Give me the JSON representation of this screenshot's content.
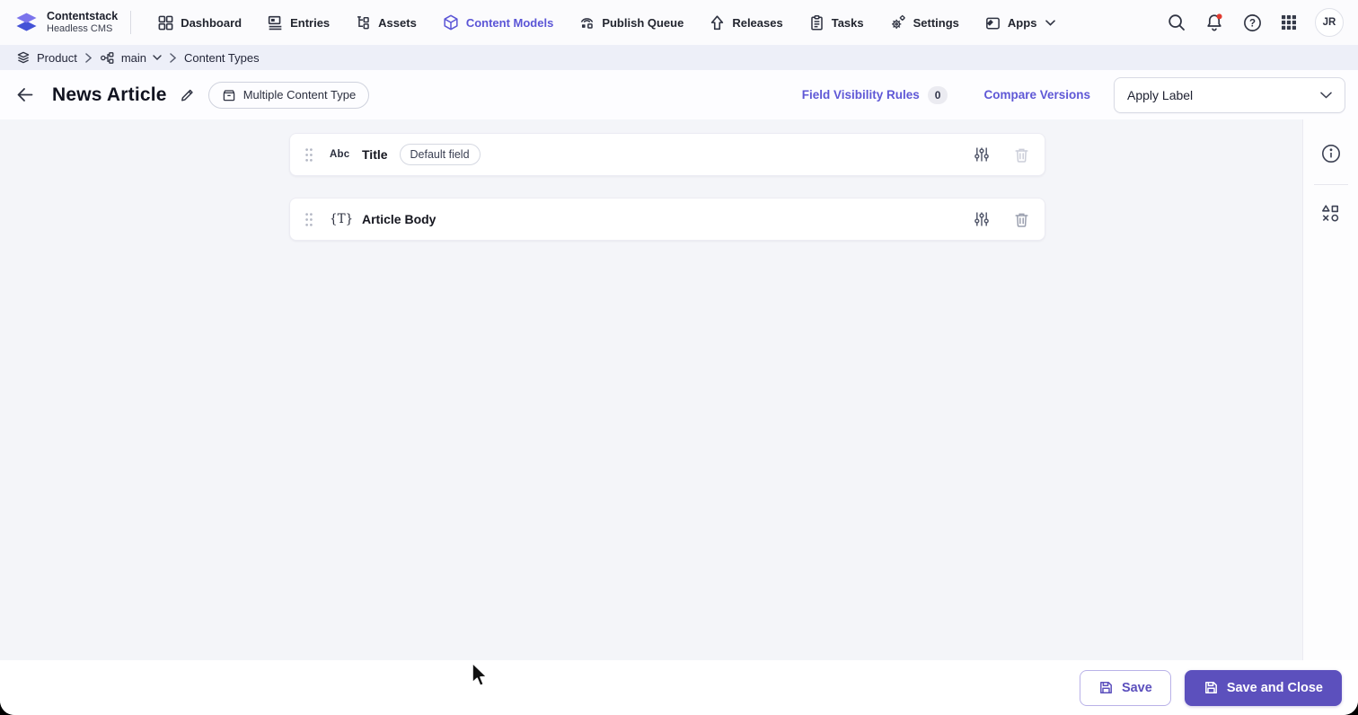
{
  "topnav": {
    "brand": {
      "title": "Contentstack",
      "subtitle": "Headless CMS"
    },
    "items": [
      {
        "label": "Dashboard",
        "active": false
      },
      {
        "label": "Entries",
        "active": false
      },
      {
        "label": "Assets",
        "active": false
      },
      {
        "label": "Content Models",
        "active": true
      },
      {
        "label": "Publish Queue",
        "active": false
      },
      {
        "label": "Releases",
        "active": false
      },
      {
        "label": "Tasks",
        "active": false
      },
      {
        "label": "Settings",
        "active": false
      },
      {
        "label": "Apps",
        "active": false
      }
    ],
    "right": {
      "avatar_initials": "JR",
      "has_notification_dot": true
    }
  },
  "breadcrumb": {
    "stack": "Product",
    "branch": "main",
    "section": "Content Types"
  },
  "page_header": {
    "title": "News Article",
    "content_type_badge": "Multiple Content Type",
    "field_visibility_rules_label": "Field Visibility Rules",
    "field_visibility_rules_count": "0",
    "compare_versions_label": "Compare Versions",
    "apply_label_placeholder": "Apply Label"
  },
  "fields": [
    {
      "name": "Title",
      "icon_glyph": "Abc",
      "type": "single-line-text",
      "badge": "Default field"
    },
    {
      "name": "Article Body",
      "icon_glyph": "{T}",
      "type": "json-rich-text",
      "badge": null
    }
  ],
  "footer": {
    "save_label": "Save",
    "save_and_close_label": "Save and Close"
  },
  "icons": {
    "dashboard-icon": "2x2 grid squares",
    "entries-icon": "document with lines",
    "assets-icon": "folder tree",
    "content-models-icon": "3d cube",
    "publish-queue-icon": "broadcast arcs over blocks",
    "releases-icon": "hollow up arrow",
    "tasks-icon": "clipboard",
    "settings-icon": "two gears",
    "apps-icon": "box with tag",
    "search-icon": "magnifier",
    "notifications-icon": "bell with red dot",
    "help-icon": "question mark circle",
    "app-grid-icon": "3x3 dots",
    "drag-handle-icon": "six dots",
    "field-settings-icon": "vertical sliders",
    "delete-field-icon": "trash can",
    "info-icon": "i in circle",
    "widgets-icon": "triangle square x circle",
    "save-icon": "floppy disk"
  },
  "colors": {
    "accent_link": "#5f58d6",
    "accent_button": "#5c50bd",
    "notification_red": "#e13a30",
    "main_background": "#f4f5f9",
    "breadcrumb_background": "#edeff8"
  }
}
